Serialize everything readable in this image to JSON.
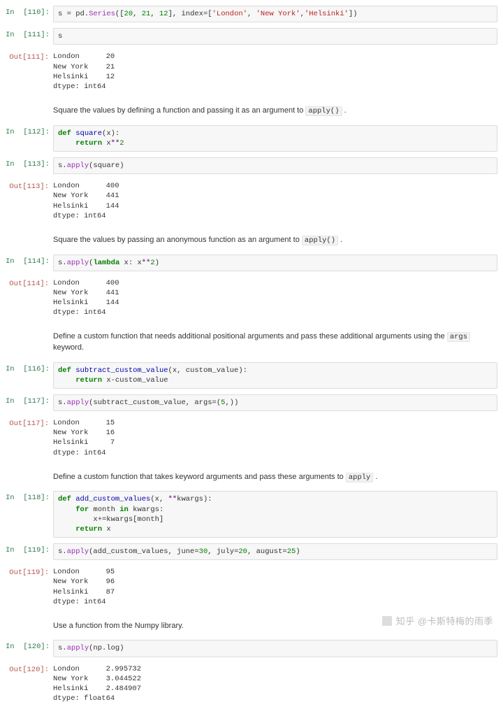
{
  "cells": [
    {
      "type": "in",
      "n": "110",
      "html": "s = pd.<span class='nfc'>Series</span>([<span class='n'>20</span>, <span class='n'>21</span>, <span class='n'>12</span>], index=[<span class='s'>'London'</span>, <span class='s'>'New York'</span>,<span class='s'>'Helsinki'</span>])"
    },
    {
      "type": "in",
      "n": "111",
      "html": "s"
    },
    {
      "type": "out",
      "n": "111",
      "text": "London      20\nNew York    21\nHelsinki    12\ndtype: int64"
    },
    {
      "type": "md",
      "text": "Square the values by defining a function and passing it as an argument to ",
      "code": "apply()",
      "tail": " ."
    },
    {
      "type": "in",
      "n": "112",
      "html": "<span class='k'>def</span> <span class='nf'>square</span>(x):\n    <span class='k'>return</span> x<span class='op'>**</span><span class='n'>2</span>"
    },
    {
      "type": "in",
      "n": "113",
      "html": "s.<span class='nfc'>apply</span>(square)"
    },
    {
      "type": "out",
      "n": "113",
      "text": "London      400\nNew York    441\nHelsinki    144\ndtype: int64"
    },
    {
      "type": "md",
      "text": "Square the values by passing an anonymous function as an argument to ",
      "code": "apply()",
      "tail": " ."
    },
    {
      "type": "in",
      "n": "114",
      "html": "s.<span class='nfc'>apply</span>(<span class='k'>lambda</span> x: x<span class='op'>**</span><span class='n'>2</span>)"
    },
    {
      "type": "out",
      "n": "114",
      "text": "London      400\nNew York    441\nHelsinki    144\ndtype: int64"
    },
    {
      "type": "md",
      "text": "Define a custom function that needs additional positional arguments and pass these additional arguments using the ",
      "code": "args",
      "tail": "  keyword."
    },
    {
      "type": "in",
      "n": "116",
      "html": "<span class='k'>def</span> <span class='nf'>subtract_custom_value</span>(x, custom_value):\n    <span class='k'>return</span> x-custom_value"
    },
    {
      "type": "in",
      "n": "117",
      "html": "s.<span class='nfc'>apply</span>(subtract_custom_value, args=(<span class='n'>5</span>,))"
    },
    {
      "type": "out",
      "n": "117",
      "text": "London      15\nNew York    16\nHelsinki     7\ndtype: int64"
    },
    {
      "type": "md",
      "text": "Define a custom function that takes keyword arguments and pass these arguments to ",
      "code": "apply",
      "tail": " ."
    },
    {
      "type": "in",
      "n": "118",
      "html": "<span class='k'>def</span> <span class='nf'>add_custom_values</span>(x, <span class='op'>**</span>kwargs):\n    <span class='k'>for</span> month <span class='k'>in</span> kwargs:\n        x+=kwargs[month]\n    <span class='k'>return</span> x"
    },
    {
      "type": "in",
      "n": "119",
      "html": "s.<span class='nfc'>apply</span>(add_custom_values, june=<span class='n'>30</span>, july=<span class='n'>20</span>, august=<span class='n'>25</span>)"
    },
    {
      "type": "out",
      "n": "119",
      "text": "London      95\nNew York    96\nHelsinki    87\ndtype: int64"
    },
    {
      "type": "md",
      "text": "Use a function from the Numpy library.",
      "code": "",
      "tail": ""
    },
    {
      "type": "in",
      "n": "120",
      "html": "s.<span class='nfc'>apply</span>(np.log)"
    },
    {
      "type": "out",
      "n": "120",
      "text": "London      2.995732\nNew York    3.044522\nHelsinki    2.484907\ndtype: float64"
    }
  ],
  "prompt_in": "In  [{n}]:",
  "prompt_out": "Out[{n}]:",
  "watermark": "知乎 @卡斯特梅的雨季"
}
